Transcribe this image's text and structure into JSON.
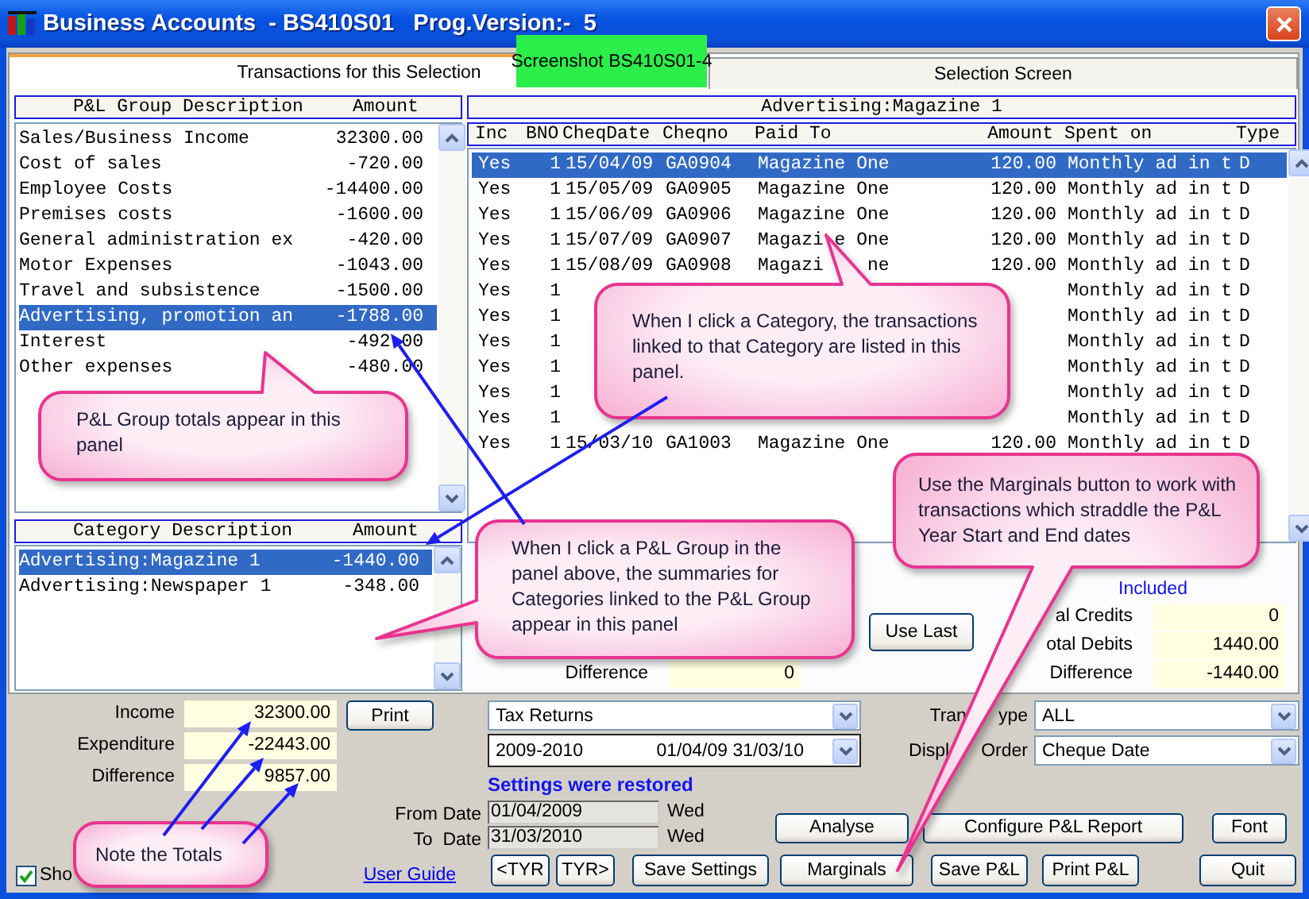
{
  "window": {
    "title": "Business Accounts  - BS410S01   Prog.Version:-  5"
  },
  "screenshot_label": "Screenshot BS410S01-4",
  "tabs": [
    {
      "label": "Transactions for this Selection",
      "selected": true
    },
    {
      "label": "Selection Screen",
      "selected": false
    }
  ],
  "pl_groups": {
    "columns": [
      "P&L Group Description",
      "Amount"
    ],
    "rows": [
      {
        "description": "Sales/Business Income",
        "amount": "32300.00",
        "selected": false
      },
      {
        "description": "Cost of sales",
        "amount": "-720.00",
        "selected": false
      },
      {
        "description": "Employee Costs",
        "amount": "-14400.00",
        "selected": false
      },
      {
        "description": "Premises costs",
        "amount": "-1600.00",
        "selected": false
      },
      {
        "description": "General administration ex",
        "amount": "-420.00",
        "selected": false
      },
      {
        "description": "Motor Expenses",
        "amount": "-1043.00",
        "selected": false
      },
      {
        "description": "Travel and subsistence",
        "amount": "-1500.00",
        "selected": false
      },
      {
        "description": "Advertising, promotion an",
        "amount": "-1788.00",
        "selected": true
      },
      {
        "description": "Interest",
        "amount": "-492.00",
        "selected": false
      },
      {
        "description": "Other expenses",
        "amount": "-480.00",
        "selected": false
      }
    ]
  },
  "categories": {
    "columns": [
      "Category Description",
      "Amount"
    ],
    "rows": [
      {
        "description": "Advertising:Magazine 1",
        "amount": "-1440.00",
        "selected": true
      },
      {
        "description": "Advertising:Newspaper 1",
        "amount": "-348.00",
        "selected": false
      }
    ]
  },
  "transactions": {
    "title": "Advertising:Magazine 1",
    "columns": [
      "Inc",
      "BNO",
      "CheqDate",
      "Cheqno",
      "Paid To",
      "Amount",
      "Spent on",
      "Type"
    ],
    "rows": [
      {
        "inc": "Yes",
        "bno": "1",
        "cheq_date": "15/04/09",
        "cheqno": "GA0904",
        "paid_to": "Magazine One",
        "amount": "120.00",
        "spent_on": "Monthly ad in t",
        "type": "D",
        "selected": true
      },
      {
        "inc": "Yes",
        "bno": "1",
        "cheq_date": "15/05/09",
        "cheqno": "GA0905",
        "paid_to": "Magazine One",
        "amount": "120.00",
        "spent_on": "Monthly ad in t",
        "type": "D",
        "selected": false
      },
      {
        "inc": "Yes",
        "bno": "1",
        "cheq_date": "15/06/09",
        "cheqno": "GA0906",
        "paid_to": "Magazine One",
        "amount": "120.00",
        "spent_on": "Monthly ad in t",
        "type": "D",
        "selected": false
      },
      {
        "inc": "Yes",
        "bno": "1",
        "cheq_date": "15/07/09",
        "cheqno": "GA0907",
        "paid_to": "Magazi",
        "paid_to_end": "e One",
        "amount": "120.00",
        "spent_on": "Monthly ad in t",
        "type": "D",
        "selected": false
      },
      {
        "inc": "Yes",
        "bno": "1",
        "cheq_date": "15/08/09",
        "cheqno": "GA0908",
        "paid_to": "Magazi",
        "paid_to_end": "ne",
        "amount": "120.00",
        "spent_on": "Monthly ad in t",
        "type": "D",
        "selected": false
      },
      {
        "inc": "Yes",
        "bno": "1",
        "spent_on": "Monthly ad in t",
        "type": "D",
        "selected": false
      },
      {
        "inc": "Yes",
        "bno": "1",
        "spent_on": "Monthly ad in t",
        "type": "D",
        "selected": false
      },
      {
        "inc": "Yes",
        "bno": "1",
        "spent_on": "Monthly ad in t",
        "type": "D",
        "selected": false
      },
      {
        "inc": "Yes",
        "bno": "1",
        "spent_on": "Monthly ad in t",
        "type": "D",
        "selected": false
      },
      {
        "inc": "Yes",
        "bno": "1",
        "spent_on": "Monthly ad in t",
        "type": "D",
        "selected": false
      },
      {
        "inc": "Yes",
        "bno": "1",
        "spent_on": "Monthly ad in t",
        "type": "D",
        "selected": false
      },
      {
        "inc": "Yes",
        "bno": "1",
        "cheq_date": "15/03/10",
        "cheqno": "GA1003",
        "paid_to": "Magazine One",
        "amount": "120.00",
        "spent_on": "Monthly ad in t",
        "type": "D",
        "selected": false
      }
    ]
  },
  "summary": {
    "included": "Included",
    "left": [
      {
        "label": "Difference",
        "value": "0"
      }
    ],
    "use_last": "Use Last",
    "right": [
      {
        "label": "al Credits",
        "value": "0"
      },
      {
        "label": "otal Debits",
        "value": "1440.00"
      },
      {
        "label": "Difference",
        "value": "-1440.00"
      }
    ]
  },
  "totals": [
    {
      "label": "Income",
      "value": "32300.00"
    },
    {
      "label": "Expenditure",
      "value": "-22443.00"
    },
    {
      "label": "Difference",
      "value": "9857.00"
    }
  ],
  "print_button": "Print",
  "show_checkbox": {
    "label": "Sho",
    "checked": true
  },
  "report": {
    "value": "Tax Returns"
  },
  "year": {
    "value": "2009-2010",
    "range": "01/04/09 31/03/10"
  },
  "trans_type": {
    "label": "Tran",
    "label_end": "ype",
    "value": "ALL"
  },
  "display_order": {
    "label": "Displ",
    "label_end": "Order",
    "value": "Cheque Date"
  },
  "status": "Settings were restored",
  "dates": [
    {
      "label": "From Date",
      "value": "01/04/2009",
      "day": "Wed"
    },
    {
      "label": "To  Date",
      "value": "31/03/2010",
      "day": "Wed"
    }
  ],
  "user_guide": "User Guide",
  "buttons_top": [
    "Analyse",
    "Configure P&L Report",
    "Font"
  ],
  "buttons_bottom": [
    "<TYR",
    "TYR>",
    "Save Settings",
    "Marginals",
    "Save P&L",
    "Print P&L",
    "Quit"
  ],
  "callouts": [
    {
      "text": "When I click a Category, the transactions linked to that Category are listed in this panel."
    },
    {
      "text": "P&L Group totals appear in this panel"
    },
    {
      "text": "When I click a P&L Group in the panel above, the summaries for Categories linked to the P&L Group appear in this panel"
    },
    {
      "text": "Use the Marginals button to work with transactions which straddle the P&L Year Start and End dates"
    },
    {
      "text": "Note the Totals"
    }
  ]
}
